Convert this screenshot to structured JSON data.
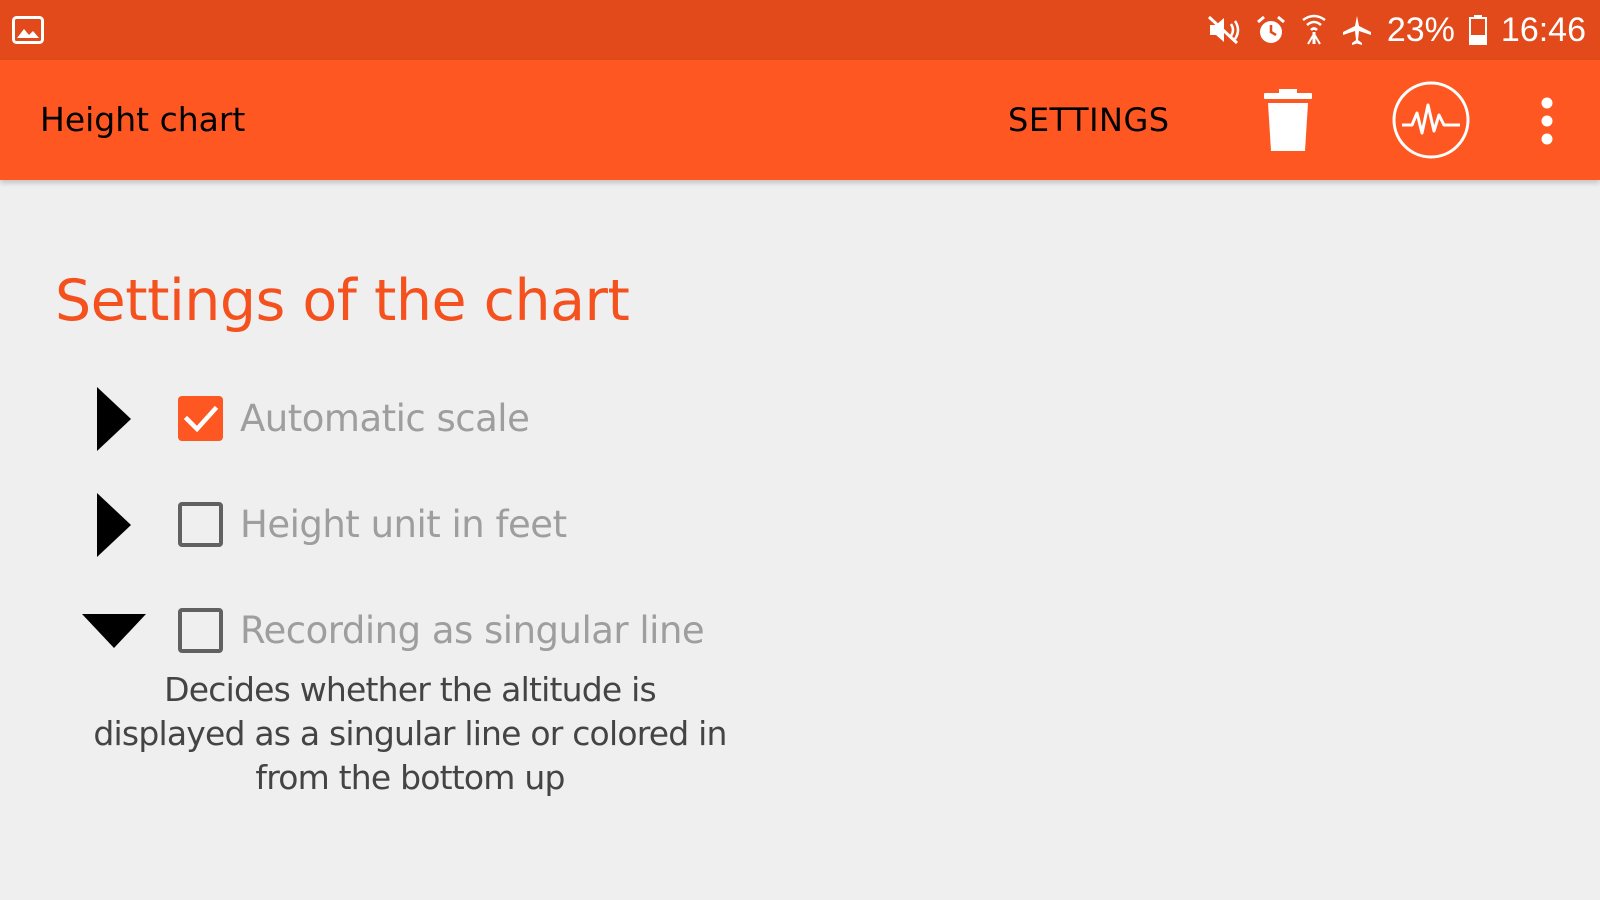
{
  "status_bar": {
    "battery": "23%",
    "time": "16:46",
    "icons": [
      "image-icon",
      "mute-icon",
      "alarm-icon",
      "wifi-icon",
      "airplane-icon",
      "battery-icon"
    ]
  },
  "app_bar": {
    "title": "Height chart",
    "settings_label": "SETTINGS",
    "icons": [
      "trash-icon",
      "pulse-icon",
      "more-vert-icon"
    ],
    "color": "#ff5722"
  },
  "section": {
    "title": "Settings of the chart",
    "title_color": "#f4511e"
  },
  "settings": [
    {
      "label": "Automatic scale",
      "checked": true,
      "expanded": false
    },
    {
      "label": "Height unit in feet",
      "checked": false,
      "expanded": false
    },
    {
      "label": "Recording as singular line",
      "checked": false,
      "expanded": true,
      "description": "Decides whether the altitude is displayed as a singular line or colored in from the bottom up"
    }
  ]
}
